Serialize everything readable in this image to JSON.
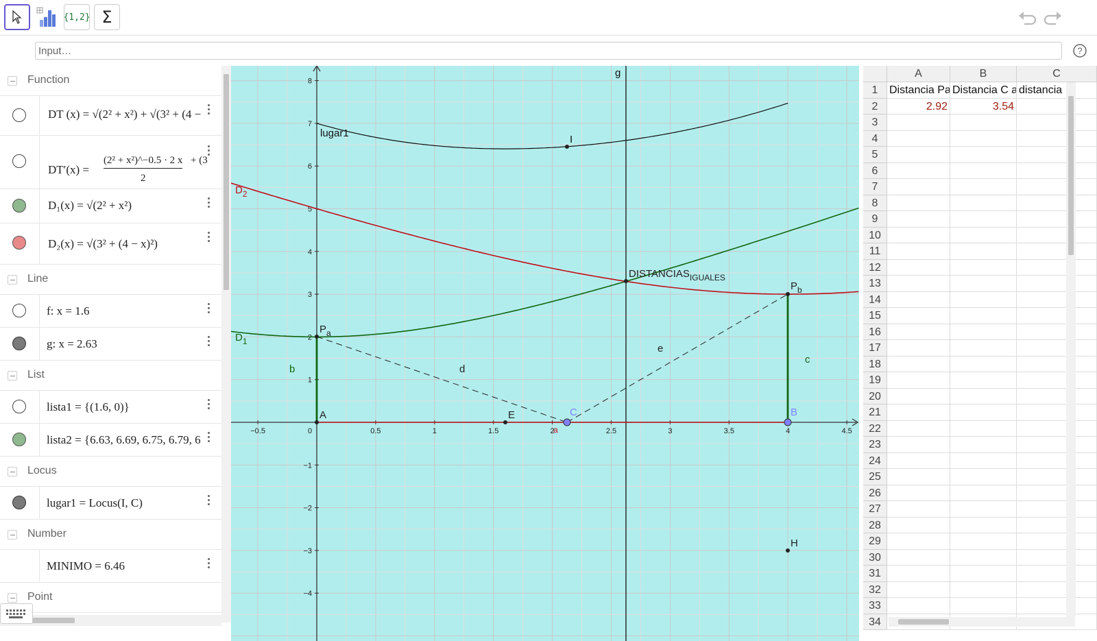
{
  "toolbar": {
    "tools": [
      {
        "name": "move-tool",
        "icon": "pointer-arrow-icon"
      },
      {
        "name": "chart-tool",
        "icon": "bar-chart-icon"
      },
      {
        "name": "list-tool",
        "label": "{1,2}"
      },
      {
        "name": "sum-tool",
        "label": "Σ"
      }
    ],
    "undo_icon": "undo-icon",
    "redo_icon": "redo-icon"
  },
  "input": {
    "placeholder": "Input…",
    "help_icon": "help-icon"
  },
  "algebra": {
    "groups": {
      "function": "Function",
      "line": "Line",
      "list": "List",
      "locus": "Locus",
      "number": "Number",
      "point": "Point"
    },
    "items": {
      "dt": "DT (x) = √(2² + x²) + √(3² + (4 −",
      "dt_prime_lhs": "DT′(x) =",
      "dt_prime_num": "(2² + x²)^−0.5 · 2 x",
      "dt_prime_den": "2",
      "dt_prime_tail": "+ (3",
      "d1": "D₁(x) = √(2² + x²)",
      "d2": "D₂(x) = √(3² + (4 − x)²)",
      "f": "f: x = 1.6",
      "g": "g: x = 2.63",
      "lista1": "lista1 = {(1.6, 0)}",
      "lista2": "lista2 = {6.63, 6.69, 6.75, 6.79, 6",
      "lugar1": "lugar1 = Locus(I, C)",
      "minimo": "MINIMO = 6.46"
    },
    "marble_colors": {
      "empty": "#ffffff",
      "green": "#8fb88f",
      "red": "#e88a8a",
      "gray": "#7a7a7a"
    }
  },
  "graphics": {
    "background": "#b2eded",
    "x_ticks": [
      "−0.5",
      "0",
      "0.5",
      "1",
      "1.5",
      "2",
      "2.5",
      "3",
      "3.5",
      "4",
      "4.5"
    ],
    "y_ticks": [
      "8",
      "7",
      "6",
      "5",
      "4",
      "3",
      "2",
      "1",
      "−1",
      "−2",
      "−3",
      "−4"
    ],
    "labels": {
      "lugar1": "lugar1",
      "I": "I",
      "D2": "D",
      "D2_sub": "2",
      "D1": "D",
      "D1_sub": "1",
      "g": "g",
      "distancias": "DISTANCIAS",
      "distancias_sub": "IGUALES",
      "Pb": "P",
      "Pb_sub": "b",
      "Pa": "P",
      "Pa_sub": "a",
      "b": "b",
      "c": "c",
      "d": "d",
      "e": "e",
      "A": "A",
      "E": "E",
      "C": "C",
      "B": "B",
      "H": "H",
      "a": "a"
    },
    "colors": {
      "red": "#c0101a",
      "green": "#116611",
      "black": "#111111",
      "point_blue": "#8080ff"
    }
  },
  "spreadsheet": {
    "columns": [
      "A",
      "B",
      "C"
    ],
    "row_count": 34,
    "cells": {
      "A1": "Distancia Pa",
      "B1": "Distancia C a",
      "C1": "distancia",
      "A2": "2.92",
      "B2": "3.54"
    },
    "value_color": "#a02010"
  }
}
